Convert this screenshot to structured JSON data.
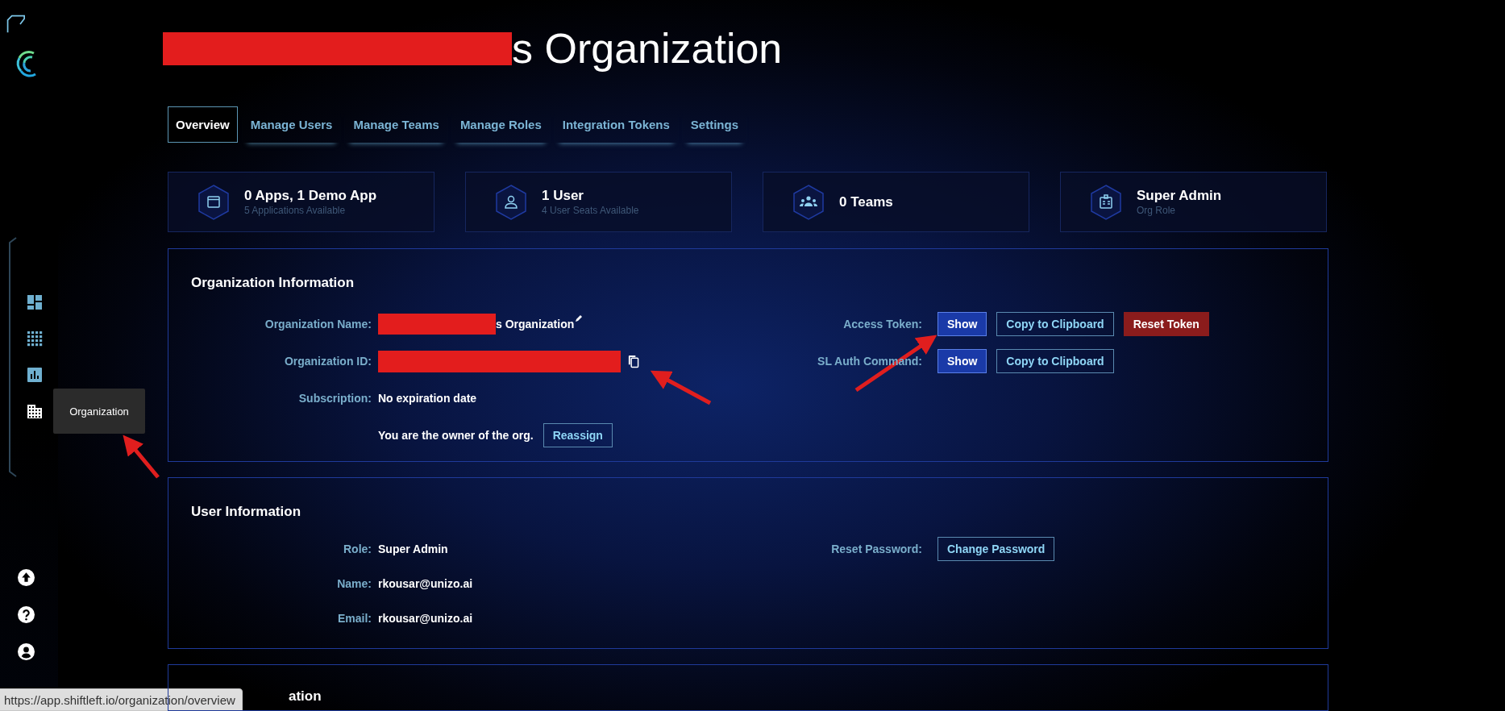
{
  "sidebar": {
    "nav": [
      {
        "kind": "dashboard",
        "selected": false
      },
      {
        "kind": "apps",
        "selected": false
      },
      {
        "kind": "chart",
        "selected": false
      },
      {
        "kind": "building",
        "selected": true
      }
    ],
    "tooltip": "Organization",
    "bottom": [
      {
        "kind": "upload"
      },
      {
        "kind": "help"
      },
      {
        "kind": "account"
      }
    ]
  },
  "title": {
    "visible_text": "s Organization",
    "redacted": true
  },
  "tabs": [
    {
      "label": "Overview",
      "selected": true
    },
    {
      "label": "Manage Users",
      "selected": false
    },
    {
      "label": "Manage Teams",
      "selected": false
    },
    {
      "label": "Manage Roles",
      "selected": false
    },
    {
      "label": "Integration Tokens",
      "selected": false
    },
    {
      "label": "Settings",
      "selected": false
    }
  ],
  "stats": [
    {
      "kind": "window",
      "title": "0 Apps, 1 Demo App",
      "subtitle": "5 Applications Available"
    },
    {
      "kind": "user",
      "title": "1 User",
      "subtitle": "4 User Seats Available"
    },
    {
      "kind": "team",
      "title": "0 Teams"
    },
    {
      "kind": "badge",
      "title": "Super Admin",
      "subtitle": "Org Role"
    }
  ],
  "organization_information": {
    "title": "Organization Information",
    "fields": [
      {
        "kind": "editable",
        "label": "Organization Name:",
        "value": "s Organization",
        "redacted": true
      },
      {
        "kind": "copyable",
        "label": "Organization ID:",
        "redacted": true
      },
      {
        "kind": "text",
        "label": "Subscription:",
        "value": "No expiration date",
        "redacted": false
      },
      {
        "kind": "action",
        "value": "You are the owner of the org.",
        "redacted": false,
        "button": "Reassign"
      }
    ],
    "tokens": [
      {
        "label": "Access Token:",
        "buttons": [
          {
            "label": "Show",
            "kind": "primary"
          },
          {
            "label": "Copy to Clipboard",
            "kind": "outline"
          },
          {
            "label": "Reset Token",
            "kind": "danger"
          }
        ]
      },
      {
        "label": "SL Auth Command:",
        "buttons": [
          {
            "label": "Show",
            "kind": "primary"
          },
          {
            "label": "Copy to Clipboard",
            "kind": "outline"
          }
        ]
      }
    ]
  },
  "user_information": {
    "title": "User Information",
    "fields": [
      {
        "label": "Role:",
        "value": "Super Admin"
      },
      {
        "label": "Name:",
        "value": "rkousar@unizo.ai"
      },
      {
        "label": "Email:",
        "value": "rkousar@unizo.ai"
      }
    ],
    "actions": [
      {
        "label": "Reset Password:",
        "button": "Change Password"
      }
    ]
  },
  "next_panel": {
    "title": "ation"
  },
  "status_bar": {
    "url": "https://app.shiftleft.io/organization/overview"
  }
}
